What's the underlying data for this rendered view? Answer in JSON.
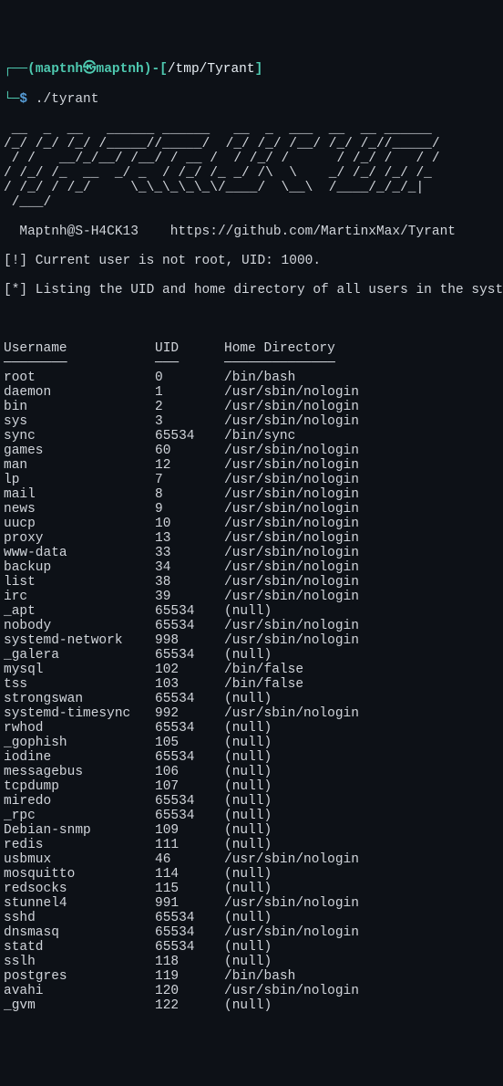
{
  "prompt": {
    "brace_open": "┌──(",
    "user": "maptnh",
    "at": "㉿",
    "host": "maptnh",
    "close1": ")-[",
    "cwd": "/tmp/Tyrant",
    "close2": "]",
    "line2a": "└─",
    "dollar": "$",
    "cmd": " ./tyrant"
  },
  "ascii_art": " __  _  __   ______ ______   __  _  ___  __  __ ______\n/_/ /_/ /_/ /_____//_____/  /_/ /_/ /__/ /_/ /_//_____/\n / /   __/_/__/ /__/ / __ /  / /_/ /      / /_/ /   / /\n/ /_/ /_  __  _/ _  / /_/ /_ _/ /\\  \\    _/ /_/ /_/ /_\n/ /_/ / /_/     \\_\\_\\_\\_\\_\\/____/  \\__\\  /____/_/_/_|\n /___/",
  "signature": "  Maptnh@S-H4CK13    https://github.com/MartinxMax/Tyrant",
  "warn1": "[!] Current user is not root, UID: 1000.",
  "warn2": "[*] Listing the UID and home directory of all users in the system:",
  "headers": {
    "user": "Username",
    "uid": "UID",
    "home": "Home Directory"
  },
  "separators": {
    "user": "────────",
    "uid": "───",
    "home": "──────────────"
  },
  "entries": [
    {
      "user": "root",
      "uid": "0",
      "home": "/bin/bash"
    },
    {
      "user": "daemon",
      "uid": "1",
      "home": "/usr/sbin/nologin"
    },
    {
      "user": "bin",
      "uid": "2",
      "home": "/usr/sbin/nologin"
    },
    {
      "user": "sys",
      "uid": "3",
      "home": "/usr/sbin/nologin"
    },
    {
      "user": "sync",
      "uid": "65534",
      "home": "/bin/sync"
    },
    {
      "user": "games",
      "uid": "60",
      "home": "/usr/sbin/nologin"
    },
    {
      "user": "man",
      "uid": "12",
      "home": "/usr/sbin/nologin"
    },
    {
      "user": "lp",
      "uid": "7",
      "home": "/usr/sbin/nologin"
    },
    {
      "user": "mail",
      "uid": "8",
      "home": "/usr/sbin/nologin"
    },
    {
      "user": "news",
      "uid": "9",
      "home": "/usr/sbin/nologin"
    },
    {
      "user": "uucp",
      "uid": "10",
      "home": "/usr/sbin/nologin"
    },
    {
      "user": "proxy",
      "uid": "13",
      "home": "/usr/sbin/nologin"
    },
    {
      "user": "www-data",
      "uid": "33",
      "home": "/usr/sbin/nologin"
    },
    {
      "user": "backup",
      "uid": "34",
      "home": "/usr/sbin/nologin"
    },
    {
      "user": "list",
      "uid": "38",
      "home": "/usr/sbin/nologin"
    },
    {
      "user": "irc",
      "uid": "39",
      "home": "/usr/sbin/nologin"
    },
    {
      "user": "_apt",
      "uid": "65534",
      "home": "(null)"
    },
    {
      "user": "nobody",
      "uid": "65534",
      "home": "/usr/sbin/nologin"
    },
    {
      "user": "systemd-network",
      "uid": "998",
      "home": "/usr/sbin/nologin"
    },
    {
      "user": "_galera",
      "uid": "65534",
      "home": "(null)"
    },
    {
      "user": "mysql",
      "uid": "102",
      "home": "/bin/false"
    },
    {
      "user": "tss",
      "uid": "103",
      "home": "/bin/false"
    },
    {
      "user": "strongswan",
      "uid": "65534",
      "home": "(null)"
    },
    {
      "user": "systemd-timesync",
      "uid": "992",
      "home": "/usr/sbin/nologin"
    },
    {
      "user": "rwhod",
      "uid": "65534",
      "home": "(null)"
    },
    {
      "user": "_gophish",
      "uid": "105",
      "home": "(null)"
    },
    {
      "user": "iodine",
      "uid": "65534",
      "home": "(null)"
    },
    {
      "user": "messagebus",
      "uid": "106",
      "home": "(null)"
    },
    {
      "user": "tcpdump",
      "uid": "107",
      "home": "(null)"
    },
    {
      "user": "miredo",
      "uid": "65534",
      "home": "(null)"
    },
    {
      "user": "_rpc",
      "uid": "65534",
      "home": "(null)"
    },
    {
      "user": "Debian-snmp",
      "uid": "109",
      "home": "(null)"
    },
    {
      "user": "redis",
      "uid": "111",
      "home": "(null)"
    },
    {
      "user": "usbmux",
      "uid": "46",
      "home": "/usr/sbin/nologin"
    },
    {
      "user": "mosquitto",
      "uid": "114",
      "home": "(null)"
    },
    {
      "user": "redsocks",
      "uid": "115",
      "home": "(null)"
    },
    {
      "user": "stunnel4",
      "uid": "991",
      "home": "/usr/sbin/nologin"
    },
    {
      "user": "sshd",
      "uid": "65534",
      "home": "(null)"
    },
    {
      "user": "dnsmasq",
      "uid": "65534",
      "home": "/usr/sbin/nologin"
    },
    {
      "user": "statd",
      "uid": "65534",
      "home": "(null)"
    },
    {
      "user": "sslh",
      "uid": "118",
      "home": "(null)"
    },
    {
      "user": "postgres",
      "uid": "119",
      "home": "/bin/bash"
    },
    {
      "user": "avahi",
      "uid": "120",
      "home": "/usr/sbin/nologin"
    },
    {
      "user": "_gvm",
      "uid": "122",
      "home": "(null)"
    }
  ]
}
